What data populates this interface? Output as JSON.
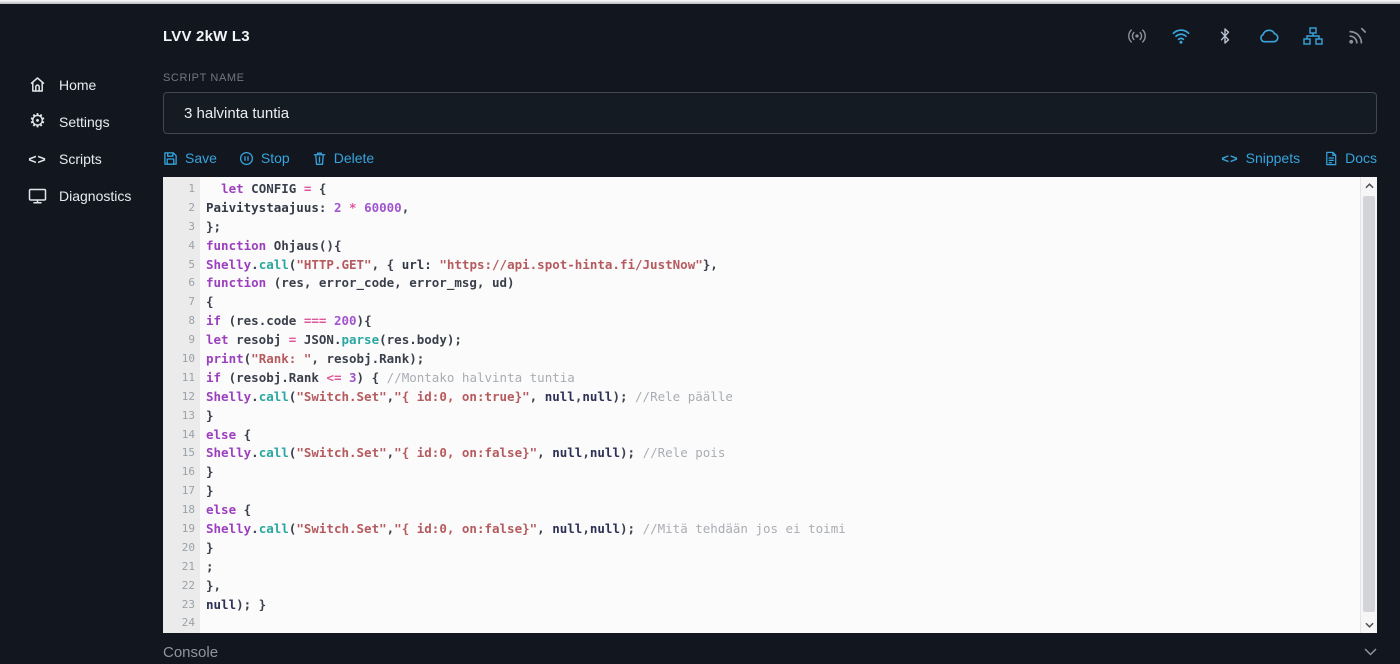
{
  "topbar": {
    "title": "LVV 2kW L3",
    "status_icons": [
      {
        "name": "access-point-icon",
        "color": "#8a929c"
      },
      {
        "name": "wifi-icon",
        "color": "#3ba4da"
      },
      {
        "name": "bluetooth-icon",
        "color": "#b9c3cf"
      },
      {
        "name": "cloud-icon",
        "color": "#3ba4da"
      },
      {
        "name": "ethernet-icon",
        "color": "#3ba4da"
      },
      {
        "name": "broadcast-icon",
        "color": "#8a929c"
      }
    ]
  },
  "sidebar": {
    "items": [
      {
        "label": "Home",
        "icon": "home-icon"
      },
      {
        "label": "Settings",
        "icon": "gear-icon"
      },
      {
        "label": "Scripts",
        "icon": "code-icon"
      },
      {
        "label": "Diagnostics",
        "icon": "monitor-icon"
      }
    ]
  },
  "script": {
    "name_label": "SCRIPT NAME",
    "name_value": "3 halvinta tuntia"
  },
  "toolbar": {
    "save_label": "Save",
    "stop_label": "Stop",
    "delete_label": "Delete",
    "snippets_label": "Snippets",
    "docs_label": "Docs",
    "accent_color": "#37a3dc"
  },
  "editor": {
    "lines": [
      {
        "n": 1,
        "t": [
          [
            "plain",
            "  "
          ],
          [
            "kw",
            "let"
          ],
          [
            "plain",
            " CONFIG "
          ],
          [
            "op",
            "="
          ],
          [
            "plain",
            " {"
          ]
        ]
      },
      {
        "n": 2,
        "t": [
          [
            "prop",
            "Paivitystaajuus"
          ],
          [
            "plain",
            ": "
          ],
          [
            "num",
            "2"
          ],
          [
            "plain",
            " "
          ],
          [
            "op",
            "*"
          ],
          [
            "plain",
            " "
          ],
          [
            "num",
            "60000"
          ],
          [
            "plain",
            ","
          ]
        ]
      },
      {
        "n": 3,
        "t": [
          [
            "plain",
            "};"
          ]
        ]
      },
      {
        "n": 4,
        "t": [
          [
            "kw",
            "function"
          ],
          [
            "plain",
            " Ohjaus(){"
          ]
        ]
      },
      {
        "n": 5,
        "t": [
          [
            "kw",
            "Shelly"
          ],
          [
            "plain",
            "."
          ],
          [
            "fn",
            "call"
          ],
          [
            "plain",
            "("
          ],
          [
            "str",
            "\"HTTP.GET\""
          ],
          [
            "plain",
            ", { "
          ],
          [
            "prop",
            "url"
          ],
          [
            "plain",
            ": "
          ],
          [
            "str",
            "\"https://api.spot-hinta.fi/JustNow\""
          ],
          [
            "plain",
            "},"
          ]
        ]
      },
      {
        "n": 6,
        "t": [
          [
            "kw",
            "function"
          ],
          [
            "plain",
            " (res, error_code, error_msg, ud)"
          ]
        ]
      },
      {
        "n": 7,
        "t": [
          [
            "plain",
            "{"
          ]
        ]
      },
      {
        "n": 8,
        "t": [
          [
            "kw",
            "if"
          ],
          [
            "plain",
            " (res.code "
          ],
          [
            "op",
            "==="
          ],
          [
            "plain",
            " "
          ],
          [
            "num",
            "200"
          ],
          [
            "plain",
            "){"
          ]
        ]
      },
      {
        "n": 9,
        "t": [
          [
            "kw",
            "let"
          ],
          [
            "plain",
            " resobj "
          ],
          [
            "op",
            "="
          ],
          [
            "plain",
            " JSON."
          ],
          [
            "fn",
            "parse"
          ],
          [
            "plain",
            "(res.body);"
          ]
        ]
      },
      {
        "n": 10,
        "t": [
          [
            "kw",
            "print"
          ],
          [
            "plain",
            "("
          ],
          [
            "str",
            "\"Rank: \""
          ],
          [
            "plain",
            ", resobj.Rank);"
          ]
        ]
      },
      {
        "n": 11,
        "t": [
          [
            "kw",
            "if"
          ],
          [
            "plain",
            " (resobj.Rank "
          ],
          [
            "op",
            "<="
          ],
          [
            "plain",
            " "
          ],
          [
            "num",
            "3"
          ],
          [
            "plain",
            ") { "
          ],
          [
            "cmt",
            "//Montako halvinta tuntia"
          ]
        ]
      },
      {
        "n": 12,
        "t": [
          [
            "kw",
            "Shelly"
          ],
          [
            "plain",
            "."
          ],
          [
            "fn",
            "call"
          ],
          [
            "plain",
            "("
          ],
          [
            "str",
            "\"Switch.Set\""
          ],
          [
            "plain",
            ","
          ],
          [
            "str",
            "\"{ id:0, on:true}\""
          ],
          [
            "plain",
            ", "
          ],
          [
            "atom",
            "null"
          ],
          [
            "plain",
            ","
          ],
          [
            "atom",
            "null"
          ],
          [
            "plain",
            "); "
          ],
          [
            "cmt",
            "//Rele päälle"
          ]
        ]
      },
      {
        "n": 13,
        "t": [
          [
            "plain",
            "}"
          ]
        ]
      },
      {
        "n": 14,
        "t": [
          [
            "kw",
            "else"
          ],
          [
            "plain",
            " {"
          ]
        ]
      },
      {
        "n": 15,
        "t": [
          [
            "kw",
            "Shelly"
          ],
          [
            "plain",
            "."
          ],
          [
            "fn",
            "call"
          ],
          [
            "plain",
            "("
          ],
          [
            "str",
            "\"Switch.Set\""
          ],
          [
            "plain",
            ","
          ],
          [
            "str",
            "\"{ id:0, on:false}\""
          ],
          [
            "plain",
            ", "
          ],
          [
            "atom",
            "null"
          ],
          [
            "plain",
            ","
          ],
          [
            "atom",
            "null"
          ],
          [
            "plain",
            "); "
          ],
          [
            "cmt",
            "//Rele pois"
          ]
        ]
      },
      {
        "n": 16,
        "t": [
          [
            "plain",
            "}"
          ]
        ]
      },
      {
        "n": 17,
        "t": [
          [
            "plain",
            "}"
          ]
        ]
      },
      {
        "n": 18,
        "t": [
          [
            "kw",
            "else"
          ],
          [
            "plain",
            " {"
          ]
        ]
      },
      {
        "n": 19,
        "t": [
          [
            "kw",
            "Shelly"
          ],
          [
            "plain",
            "."
          ],
          [
            "fn",
            "call"
          ],
          [
            "plain",
            "("
          ],
          [
            "str",
            "\"Switch.Set\""
          ],
          [
            "plain",
            ","
          ],
          [
            "str",
            "\"{ id:0, on:false}\""
          ],
          [
            "plain",
            ", "
          ],
          [
            "atom",
            "null"
          ],
          [
            "plain",
            ","
          ],
          [
            "atom",
            "null"
          ],
          [
            "plain",
            "); "
          ],
          [
            "cmt",
            "//Mitä tehdään jos ei toimi"
          ]
        ]
      },
      {
        "n": 20,
        "t": [
          [
            "plain",
            "}"
          ]
        ]
      },
      {
        "n": 21,
        "t": [
          [
            "plain",
            ";"
          ]
        ]
      },
      {
        "n": 22,
        "t": [
          [
            "plain",
            "},"
          ]
        ]
      },
      {
        "n": 23,
        "t": [
          [
            "atom",
            "null"
          ],
          [
            "plain",
            "); }"
          ]
        ]
      },
      {
        "n": 24,
        "t": []
      }
    ],
    "syntax_colors": {
      "keyword": "#9c3fbe",
      "plain": "#3a3f4b",
      "property": "#333845",
      "function": "#2aa7a0",
      "operator": "#e0569b",
      "number": "#a254cf",
      "string": "#b55a5e",
      "comment": "#a9adb3",
      "atom": "#2d3156",
      "background": "#fbfbfb",
      "gutter": "#ebebeb",
      "line_number": "#9aa1a8"
    }
  },
  "console": {
    "label": "Console"
  }
}
